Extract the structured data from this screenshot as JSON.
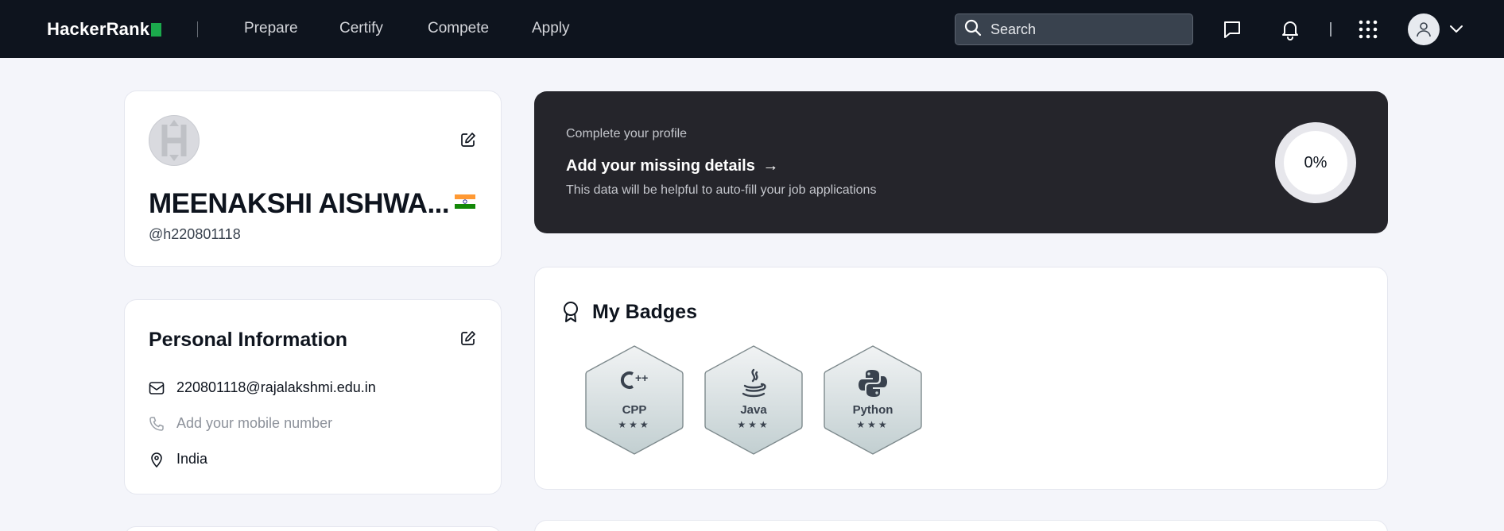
{
  "brand": {
    "name": "HackerRank",
    "accent": "#1ba94c"
  },
  "nav": {
    "links": [
      "Prepare",
      "Certify",
      "Compete",
      "Apply"
    ],
    "search_placeholder": "Search",
    "icons": [
      "message-icon",
      "bell-icon",
      "apps-grid-icon",
      "user-avatar-icon",
      "chevron-down-icon"
    ]
  },
  "profile": {
    "name": "MEENAKSHI AISHWA...",
    "handle": "@h220801118",
    "country_flag": "india-flag-icon"
  },
  "personal_info": {
    "title": "Personal Information",
    "email": "220801118@rajalakshmi.edu.in",
    "phone_placeholder": "Add your mobile number",
    "location": "India"
  },
  "complete_profile": {
    "eyebrow": "Complete your profile",
    "title": "Add your missing details",
    "arrow": "→",
    "subtitle": "This data will be helpful to auto-fill your job applications",
    "progress_percent": 0,
    "progress_label": "0%"
  },
  "badges": {
    "title": "My Badges",
    "items": [
      {
        "name": "CPP",
        "stars": "★★★",
        "icon": "cpp-icon"
      },
      {
        "name": "Java",
        "stars": "★★★",
        "icon": "java-icon"
      },
      {
        "name": "Python",
        "stars": "★★★",
        "icon": "python-icon"
      }
    ]
  },
  "colors": {
    "topbar": "#0e141e",
    "page_bg": "#f4f5fa",
    "dark_card": "#25252b"
  }
}
